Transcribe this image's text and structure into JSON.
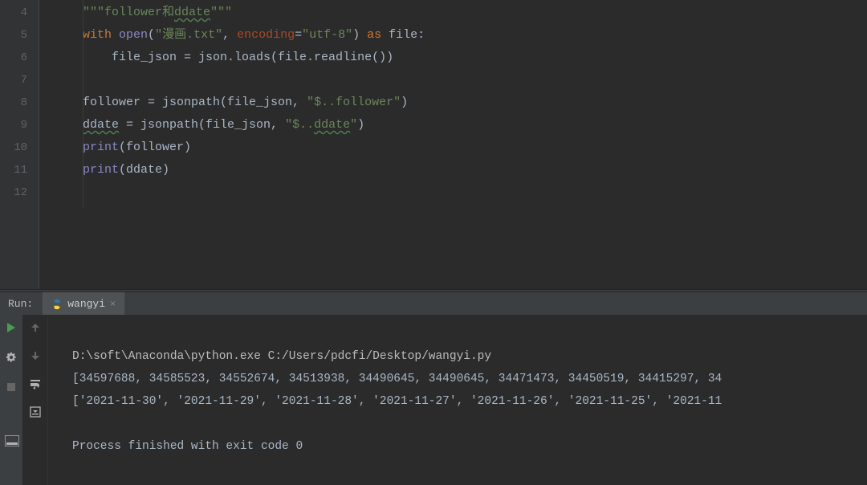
{
  "editor": {
    "lines": {
      "l4_docstring_open": "\"\"\"follower",
      "l4_and": "和",
      "l4_ddate": "ddate",
      "l4_docstring_close": "\"\"\"",
      "l5_with": "with",
      "l5_open": "open",
      "l5_path": "\"漫画.txt\"",
      "l5_comma": ", ",
      "l5_encoding_kw": "encoding",
      "l5_eq": "=",
      "l5_encoding_val": "\"utf-8\"",
      "l5_as": " as ",
      "l5_file": "file:",
      "l6_filejson": "file_json = json.loads(file.readline())",
      "l8_follower": "follower = ",
      "l8_jsonpath": "jsonpath",
      "l8_call": "(file_json, ",
      "l8_expr": "\"$..follower\"",
      "l8_close": ")",
      "l9_ddate": "ddate",
      "l9_eq": " = ",
      "l9_jsonpath": "jsonpath",
      "l9_call": "(file_json, ",
      "l9_expr_a": "\"$..",
      "l9_expr_b": "ddate",
      "l9_expr_c": "\"",
      "l9_close": ")",
      "l10_print": "print",
      "l10_arg": "(follower)",
      "l11_print": "print",
      "l11_arg": "(ddate)"
    },
    "gutter_start": 4,
    "gutter_end": 12
  },
  "run": {
    "panel_label": "Run:",
    "tab_name": "wangyi",
    "console_path": "D:\\soft\\Anaconda\\python.exe C:/Users/pdcfi/Desktop/wangyi.py",
    "console_follower": "[34597688, 34585523, 34552674, 34513938, 34490645, 34490645, 34471473, 34450519, 34415297, 34",
    "console_ddate": "['2021-11-30', '2021-11-29', '2021-11-28', '2021-11-27', '2021-11-26', '2021-11-25', '2021-11",
    "console_exit": "Process finished with exit code 0"
  }
}
